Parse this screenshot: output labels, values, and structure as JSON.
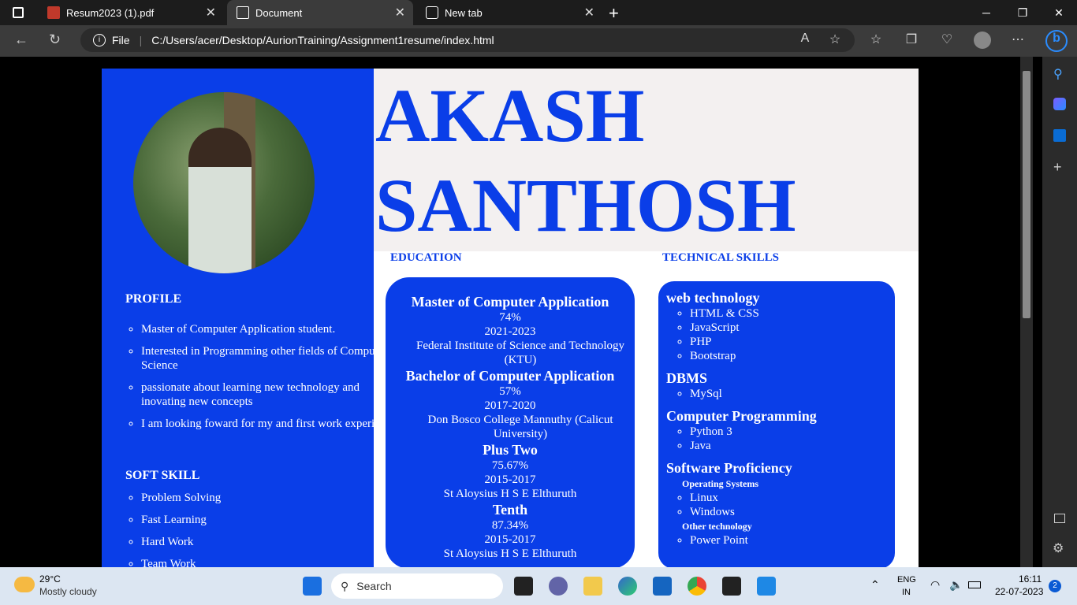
{
  "browser": {
    "tabs": [
      {
        "label": "Resum2023 (1).pdf"
      },
      {
        "label": "Document"
      },
      {
        "label": "New tab"
      }
    ],
    "file_label": "File",
    "url": "C:/Users/acer/Desktop/AurionTraining/Assignment1resume/index.html"
  },
  "resume": {
    "first_name": "AKASH",
    "last_name": "SANTHOSH",
    "profile_title": "PROFILE",
    "profile_items": [
      "Master of Computer Application student.",
      "Interested in Programming other fields of Computer Science",
      "passionate about learning new technology and inovating new concepts",
      "I am looking foward for my and first work experience."
    ],
    "soft_skill_title": "SOFT SKILL",
    "soft_skills": [
      "Problem Solving",
      "Fast Learning",
      "Hard Work",
      "Team Work"
    ],
    "education_title": "EDUCATION",
    "education": [
      {
        "degree": "Master of Computer Application",
        "score": "74%",
        "years": "2021-2023",
        "school": "Federal Institute of Science and Technology (KTU)"
      },
      {
        "degree": "Bachelor of Computer Application",
        "score": "57%",
        "years": "2017-2020",
        "school": "Don Bosco College Mannuthy (Calicut University)"
      },
      {
        "degree": "Plus Two",
        "score": "75.67%",
        "years": "2015-2017",
        "school": "St Aloysius H S E Elthuruth"
      },
      {
        "degree": "Tenth",
        "score": "87.34%",
        "years": "2015-2017",
        "school": "St Aloysius H S E Elthuruth"
      }
    ],
    "tech_title": "TECHNICAL SKILLS",
    "tech": {
      "web_title": "web technology",
      "web": [
        "HTML & CSS",
        "JavaScript",
        "PHP",
        "Bootstrap"
      ],
      "dbms_title": "DBMS",
      "dbms": [
        "MySql"
      ],
      "prog_title": "Computer Programming",
      "prog": [
        "Python 3",
        "Java"
      ],
      "soft_title": "Software Proficiency",
      "os_title": "Operating Systems",
      "os": [
        "Linux",
        "Windows"
      ],
      "other_title": "Other technology",
      "other": [
        "Power Point"
      ]
    }
  },
  "taskbar": {
    "temp": "29°C",
    "weather": "Mostly cloudy",
    "search": "Search",
    "lang1": "ENG",
    "lang2": "IN",
    "time": "16:11",
    "date": "22-07-2023",
    "badge": "2"
  }
}
